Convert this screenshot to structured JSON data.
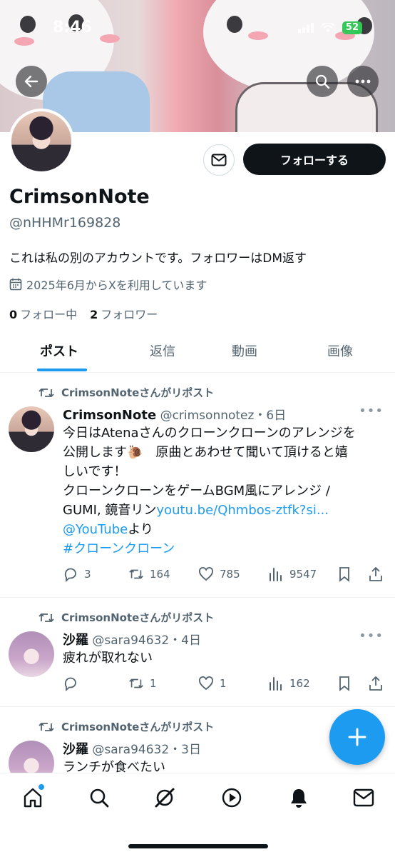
{
  "status_bar": {
    "time": "8:46",
    "battery": "52"
  },
  "profile": {
    "name": "CrimsonNote",
    "handle": "@nHHMr169828",
    "bio": "これは私の別のアカウントです。フォロワーはDM返す",
    "joined": "2025年6月からXを利用しています",
    "following_count": "0",
    "following_label": "フォロー中",
    "followers_count": "2",
    "followers_label": "フォロワー",
    "follow_button": "フォローする"
  },
  "tabs": [
    {
      "label": "ポスト",
      "active": true
    },
    {
      "label": "返信",
      "active": false
    },
    {
      "label": "動画",
      "active": false
    },
    {
      "label": "画像",
      "active": false
    }
  ],
  "posts": [
    {
      "repost_label": "CrimsonNoteさんがリポスト",
      "author": "CrimsonNote",
      "handle_time": "@crimsonnotez・6日",
      "text_line1": "今日はAtenaさんのクローンクローンのアレンジを",
      "text_line2": "公開します🐌　原曲とあわせて聞いて頂けると嬉",
      "text_line3": "しいです！",
      "text_line4": "クローンクローンをゲームBGM風にアレンジ /",
      "text_line5_a": "GUMI, 鏡音リン",
      "text_line5_link": "youtu.be/Qhmbos-ztfk?si...",
      "text_line6_link": "@YouTube",
      "text_line6_b": "より",
      "hashtag": "#クローンクローン",
      "replies": "3",
      "reposts": "164",
      "likes": "785",
      "views": "9547"
    },
    {
      "repost_label": "CrimsonNoteさんがリポスト",
      "author": "沙羅",
      "handle_time": "@sara94632・4日",
      "text": "疲れが取れない",
      "replies": "",
      "reposts": "1",
      "likes": "1",
      "views": "162"
    },
    {
      "repost_label": "CrimsonNoteさんがリポスト",
      "author": "沙羅",
      "handle_time": "@sara94632・3日",
      "text": "ランチが食べたい"
    }
  ],
  "icons": {
    "back": "arrow-left-icon",
    "search": "search-icon",
    "more": "more-icon",
    "mail": "mail-icon",
    "calendar": "calendar-icon",
    "reply": "reply-icon",
    "repost": "repost-icon",
    "like": "heart-icon",
    "views": "views-icon",
    "bookmark": "bookmark-icon",
    "share": "share-icon",
    "compose": "plus-icon",
    "nav": [
      "home-icon",
      "search-icon",
      "grok-icon",
      "play-icon",
      "bell-icon",
      "mail-icon"
    ]
  },
  "colors": {
    "accent": "#1d9bf0",
    "text": "#0f1419",
    "muted": "#536471"
  }
}
